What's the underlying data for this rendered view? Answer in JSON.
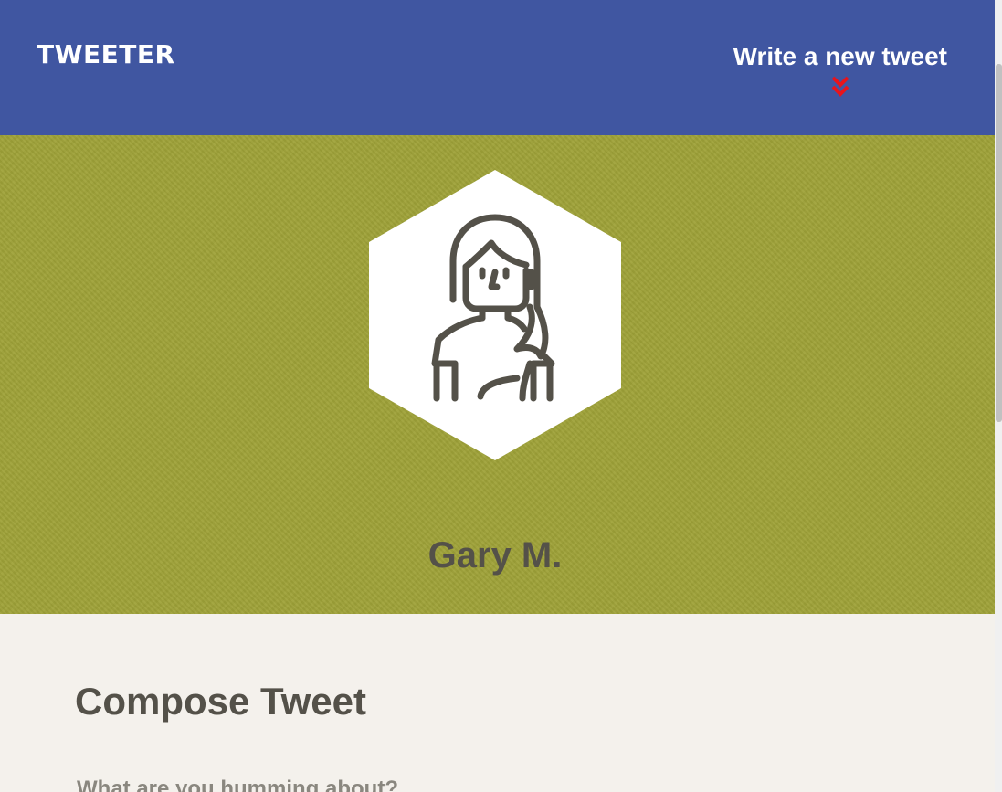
{
  "nav": {
    "logo": "TWEETER",
    "compose_link_label": "Write a new tweet",
    "compose_link_icon": "double-chevron-down-icon",
    "background_color": "#4056a1",
    "icon_color": "#e8141c"
  },
  "profile": {
    "name": "Gary M.",
    "avatar_icon": "woman-avatar-icon",
    "background_color": "#9fa238"
  },
  "compose": {
    "title": "Compose Tweet",
    "prompt": "What are you humming about?"
  }
}
